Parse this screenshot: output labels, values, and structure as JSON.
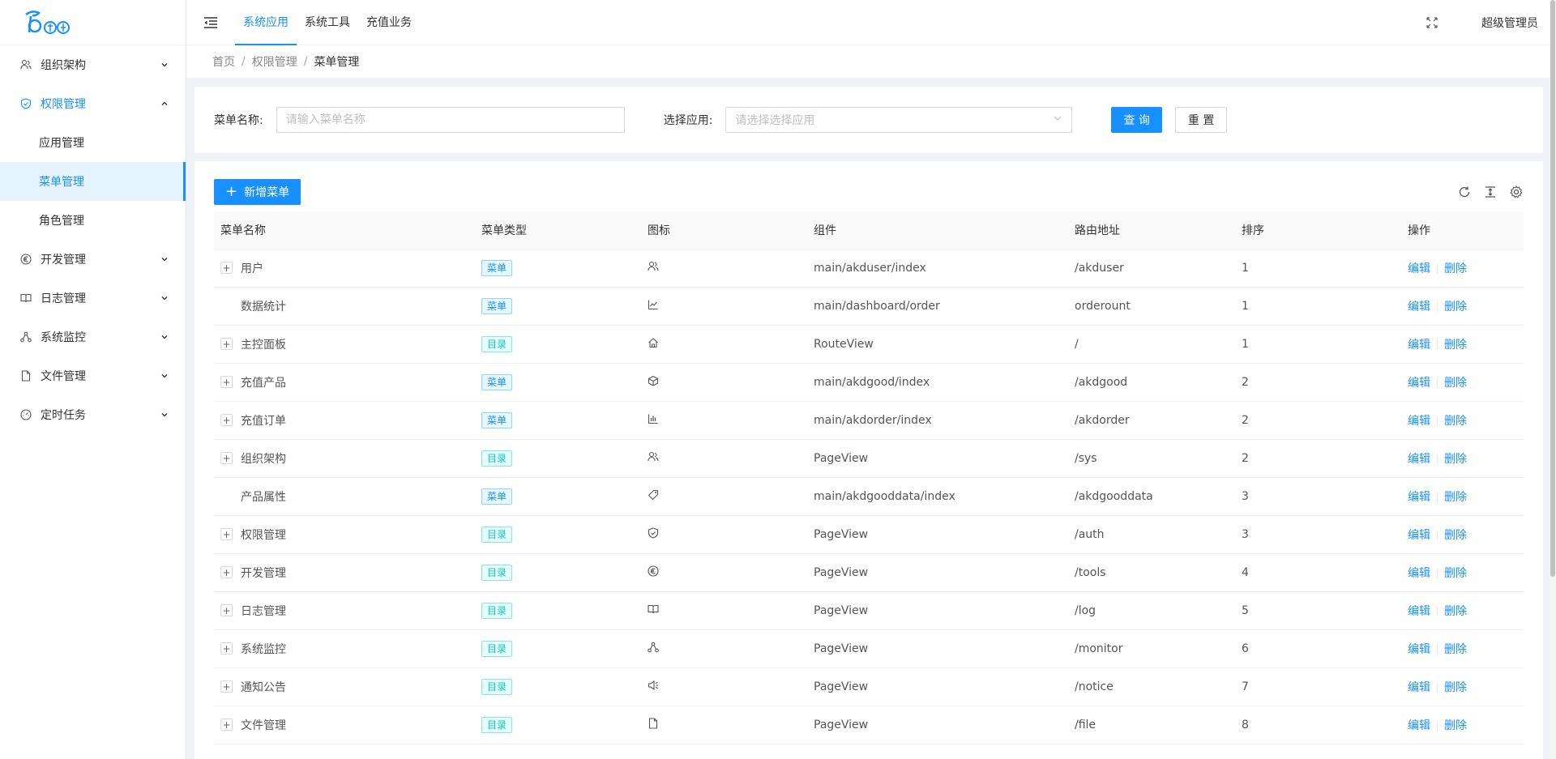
{
  "sidebar": {
    "logo_alt": "logo",
    "items": [
      {
        "label": "组织架构",
        "icon": "users-icon",
        "open": false
      },
      {
        "label": "权限管理",
        "icon": "shield-icon",
        "open": true,
        "children": [
          {
            "label": "应用管理",
            "active": false
          },
          {
            "label": "菜单管理",
            "active": true
          },
          {
            "label": "角色管理",
            "active": false
          }
        ]
      },
      {
        "label": "开发管理",
        "icon": "euro-icon",
        "open": false
      },
      {
        "label": "日志管理",
        "icon": "book-icon",
        "open": false
      },
      {
        "label": "系统监控",
        "icon": "cluster-icon",
        "open": false
      },
      {
        "label": "文件管理",
        "icon": "file-icon",
        "open": false
      },
      {
        "label": "定时任务",
        "icon": "dashboard-icon",
        "open": false
      }
    ]
  },
  "header": {
    "tabs": [
      {
        "label": "系统应用",
        "active": true
      },
      {
        "label": "系统工具",
        "active": false
      },
      {
        "label": "充值业务",
        "active": false
      }
    ],
    "user": "超级管理员"
  },
  "breadcrumb": [
    "首页",
    "权限管理",
    "菜单管理"
  ],
  "search": {
    "name_label": "菜单名称:",
    "name_placeholder": "请输入菜单名称",
    "app_label": "选择应用:",
    "app_placeholder": "请选择选择应用",
    "query_label": "查 询",
    "reset_label": "重 置"
  },
  "table": {
    "add_label": "新增菜单",
    "columns": [
      "菜单名称",
      "菜单类型",
      "图标",
      "组件",
      "路由地址",
      "排序",
      "操作"
    ],
    "edit_label": "编辑",
    "delete_label": "删除",
    "rows": [
      {
        "name": "用户",
        "expandable": true,
        "type": "菜单",
        "kind": "menu",
        "icon": "users-icon",
        "component": "main/akduser/index",
        "path": "/akduser",
        "sort": "1"
      },
      {
        "name": "数据统计",
        "expandable": false,
        "type": "菜单",
        "kind": "menu",
        "icon": "line-chart-icon",
        "component": "main/dashboard/order",
        "path": "orderount",
        "sort": "1"
      },
      {
        "name": "主控面板",
        "expandable": true,
        "type": "目录",
        "kind": "dir",
        "icon": "home-icon",
        "component": "RouteView",
        "path": "/",
        "sort": "1"
      },
      {
        "name": "充值产品",
        "expandable": true,
        "type": "菜单",
        "kind": "menu",
        "icon": "box-icon",
        "component": "main/akdgood/index",
        "path": "/akdgood",
        "sort": "2"
      },
      {
        "name": "充值订单",
        "expandable": true,
        "type": "菜单",
        "kind": "menu",
        "icon": "bar-chart-icon",
        "component": "main/akdorder/index",
        "path": "/akdorder",
        "sort": "2"
      },
      {
        "name": "组织架构",
        "expandable": true,
        "type": "目录",
        "kind": "dir",
        "icon": "users-icon",
        "component": "PageView",
        "path": "/sys",
        "sort": "2"
      },
      {
        "name": "产品属性",
        "expandable": false,
        "type": "菜单",
        "kind": "menu",
        "icon": "tag-icon",
        "component": "main/akdgooddata/index",
        "path": "/akdgooddata",
        "sort": "3"
      },
      {
        "name": "权限管理",
        "expandable": true,
        "type": "目录",
        "kind": "dir",
        "icon": "shield-icon",
        "component": "PageView",
        "path": "/auth",
        "sort": "3"
      },
      {
        "name": "开发管理",
        "expandable": true,
        "type": "目录",
        "kind": "dir",
        "icon": "euro-icon",
        "component": "PageView",
        "path": "/tools",
        "sort": "4"
      },
      {
        "name": "日志管理",
        "expandable": true,
        "type": "目录",
        "kind": "dir",
        "icon": "book-icon",
        "component": "PageView",
        "path": "/log",
        "sort": "5"
      },
      {
        "name": "系统监控",
        "expandable": true,
        "type": "目录",
        "kind": "dir",
        "icon": "cluster-icon",
        "component": "PageView",
        "path": "/monitor",
        "sort": "6"
      },
      {
        "name": "通知公告",
        "expandable": true,
        "type": "目录",
        "kind": "dir",
        "icon": "sound-icon",
        "component": "PageView",
        "path": "/notice",
        "sort": "7"
      },
      {
        "name": "文件管理",
        "expandable": true,
        "type": "目录",
        "kind": "dir",
        "icon": "file-icon",
        "component": "PageView",
        "path": "/file",
        "sort": "8"
      }
    ]
  },
  "colors": {
    "primary": "#1890ff",
    "dir_tag": "#13c2c2",
    "menu_tag": "#1890ff"
  }
}
